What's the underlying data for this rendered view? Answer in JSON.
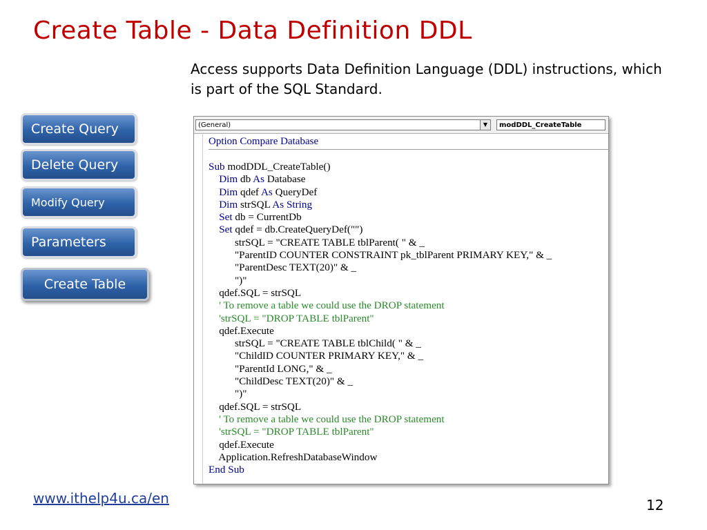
{
  "title": "Create Table - Data Definition DDL",
  "intro": {
    "line1": "Access supports Data Definition Language (DDL) instructions, which",
    "line2": "is part of the SQL Standard."
  },
  "nav": {
    "items": [
      {
        "label": "Create Query"
      },
      {
        "label": "Delete Query"
      },
      {
        "label": "Modify Query"
      },
      {
        "label": "Parameters"
      },
      {
        "label": "Create Table"
      }
    ]
  },
  "editor": {
    "object_combo": "(General)",
    "proc_combo": "modDDL_CreateTable",
    "declaration": [
      {
        "t": "Option Compare Database",
        "k": false
      }
    ],
    "lines": [
      [
        {
          "t": "Sub ",
          "k": true
        },
        {
          "t": "modDDL_CreateTable()"
        }
      ],
      [
        {
          "t": "    "
        },
        {
          "t": "Dim ",
          "k": true
        },
        {
          "t": "db "
        },
        {
          "t": "As ",
          "k": true
        },
        {
          "t": "Database"
        }
      ],
      [
        {
          "t": "    "
        },
        {
          "t": "Dim ",
          "k": true
        },
        {
          "t": "qdef "
        },
        {
          "t": "As ",
          "k": true
        },
        {
          "t": "QueryDef"
        }
      ],
      [
        {
          "t": "    "
        },
        {
          "t": "Dim ",
          "k": true
        },
        {
          "t": "strSQL "
        },
        {
          "t": "As String",
          "k": true
        }
      ],
      [
        {
          "t": "    "
        },
        {
          "t": "Set ",
          "k": true
        },
        {
          "t": "db = CurrentDb"
        }
      ],
      [
        {
          "t": "    "
        },
        {
          "t": "Set ",
          "k": true
        },
        {
          "t": "qdef = db.CreateQueryDef(\"\")"
        }
      ],
      [
        {
          "t": "          strSQL = \"CREATE TABLE tblParent( \" & _"
        }
      ],
      [
        {
          "t": "          \"ParentID COUNTER CONSTRAINT pk_tblParent PRIMARY KEY,\" & _"
        }
      ],
      [
        {
          "t": "          \"ParentDesc TEXT(20)\" & _"
        }
      ],
      [
        {
          "t": "          \")\""
        }
      ],
      [
        {
          "t": "    qdef.SQL = strSQL"
        }
      ],
      [
        {
          "t": "    ' To remove a table we could use the DROP statement",
          "c": true
        }
      ],
      [
        {
          "t": "    'strSQL = \"DROP TABLE tblParent\"",
          "c": true
        }
      ],
      [
        {
          "t": "    qdef.Execute"
        }
      ],
      [
        {
          "t": "          strSQL = \"CREATE TABLE tblChild( \" & _"
        }
      ],
      [
        {
          "t": "          \"ChildID COUNTER PRIMARY KEY,\" & _"
        }
      ],
      [
        {
          "t": "          \"ParentId LONG,\" & _"
        }
      ],
      [
        {
          "t": "          \"ChildDesc TEXT(20)\" & _"
        }
      ],
      [
        {
          "t": "          \")\""
        }
      ],
      [
        {
          "t": "    qdef.SQL = strSQL"
        }
      ],
      [
        {
          "t": "    ' To remove a table we could use the DROP statement",
          "c": true
        }
      ],
      [
        {
          "t": "    'strSQL = \"DROP TABLE tblParent\"",
          "c": true
        }
      ],
      [
        {
          "t": "    qdef.Execute"
        }
      ],
      [
        {
          "t": "    Application.RefreshDatabaseWindow"
        }
      ],
      [
        {
          "t": "End Sub",
          "k": true
        }
      ]
    ]
  },
  "footer": {
    "link": "www.ithelp4u.ca/en",
    "page_number": "12"
  }
}
